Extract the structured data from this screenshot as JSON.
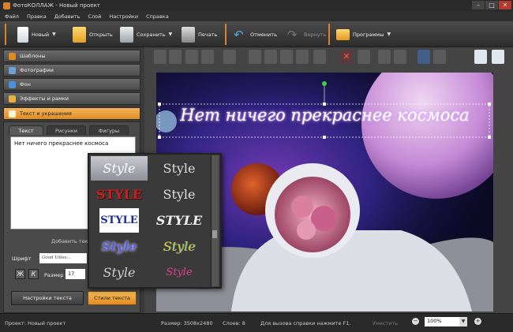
{
  "app": {
    "title": "ФотоКОЛЛАЖ - Новый проект"
  },
  "window": {
    "minimize": "–",
    "maximize": "□",
    "close": "✕"
  },
  "menu": [
    "Файл",
    "Правка",
    "Добавить",
    "Слой",
    "Настройки",
    "Справка"
  ],
  "toolbar": {
    "new": "Новый",
    "open": "Открыть",
    "save": "Сохранить",
    "print": "Печать",
    "undo": "Отменить",
    "redo": "Вернуть",
    "programs": "Программы"
  },
  "sidebar": {
    "items": [
      {
        "label": "Шаблоны",
        "icon": "templates-icon"
      },
      {
        "label": "Фотографии",
        "icon": "photos-icon"
      },
      {
        "label": "Фон",
        "icon": "background-icon"
      },
      {
        "label": "Эффекты и рамки",
        "icon": "effects-icon"
      },
      {
        "label": "Текст и украшения",
        "icon": "text-icon"
      }
    ]
  },
  "panel": {
    "tabs": [
      "Текст",
      "Рисунки",
      "Фигуры"
    ],
    "text_value": "Нет ничего прекраснее космоса",
    "add_text_label": "Добавить текст",
    "font_label": "Шрифт",
    "font_value": "Good Vibes...",
    "bold_label": "Ж",
    "italic_label": "К",
    "size_label": "Размер",
    "size_value": "17",
    "text_settings_button": "Настройки текста",
    "text_styles_button": "Стили текста"
  },
  "canvas": {
    "caption": "Нет ничего прекраснее космоса"
  },
  "styles_popup": {
    "items": [
      "Style",
      "Style",
      "STYLE",
      "Style",
      "STYLE",
      "STYLE",
      "Style",
      "Style",
      "Style",
      "Style"
    ]
  },
  "status": {
    "project": "Проект:  Новый проект",
    "size": "Размер:  3508x2480",
    "layers": "Слоев:  8",
    "help": "Для вызова справки нажмите F1.",
    "fit": "Уместить",
    "zoom": "100%"
  },
  "colors": {
    "accent": "#e08c22",
    "accent_light": "#f6bb5a",
    "panel": "#3a3a3a"
  }
}
